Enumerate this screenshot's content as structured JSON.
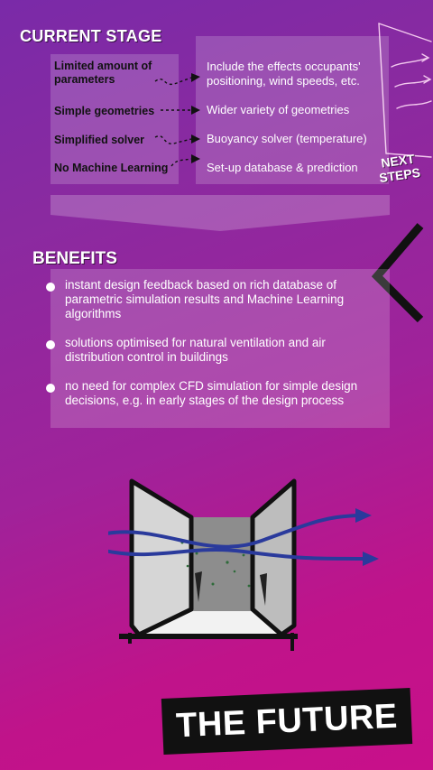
{
  "current_stage": {
    "title": "CURRENT STAGE",
    "left_items": [
      "Limited amount of parameters",
      "Simple geometries",
      "Simplified solver",
      "No Machine Learning"
    ],
    "right_items": [
      "Include the effects occupants' positioning, wind speeds, etc.",
      "Wider variety of geometries",
      "Buoyancy solver (temperature)",
      "Set-up database & prediction"
    ],
    "next_steps_label": "NEXT STEPS"
  },
  "benefits": {
    "title": "BENEFITS",
    "items": [
      "instant design feedback based on rich database of parametric simulation results and Machine Learning algorithms",
      "solutions optimised for natural ventilation and air distribution control in buildings",
      "no need for complex CFD simulation for simple design decisions, e.g. in early stages of the design process"
    ]
  },
  "footer": {
    "banner_text": "THE FUTURE"
  },
  "colors": {
    "background_top": "#7a2aa8",
    "background_bottom": "#c8108a",
    "arrow_blue": "#2a3a9c",
    "banner_black": "#111111"
  },
  "icons": [
    "wind-flow-icon",
    "chevron-left-icon",
    "down-arrow-shape",
    "building-section-illustration"
  ]
}
